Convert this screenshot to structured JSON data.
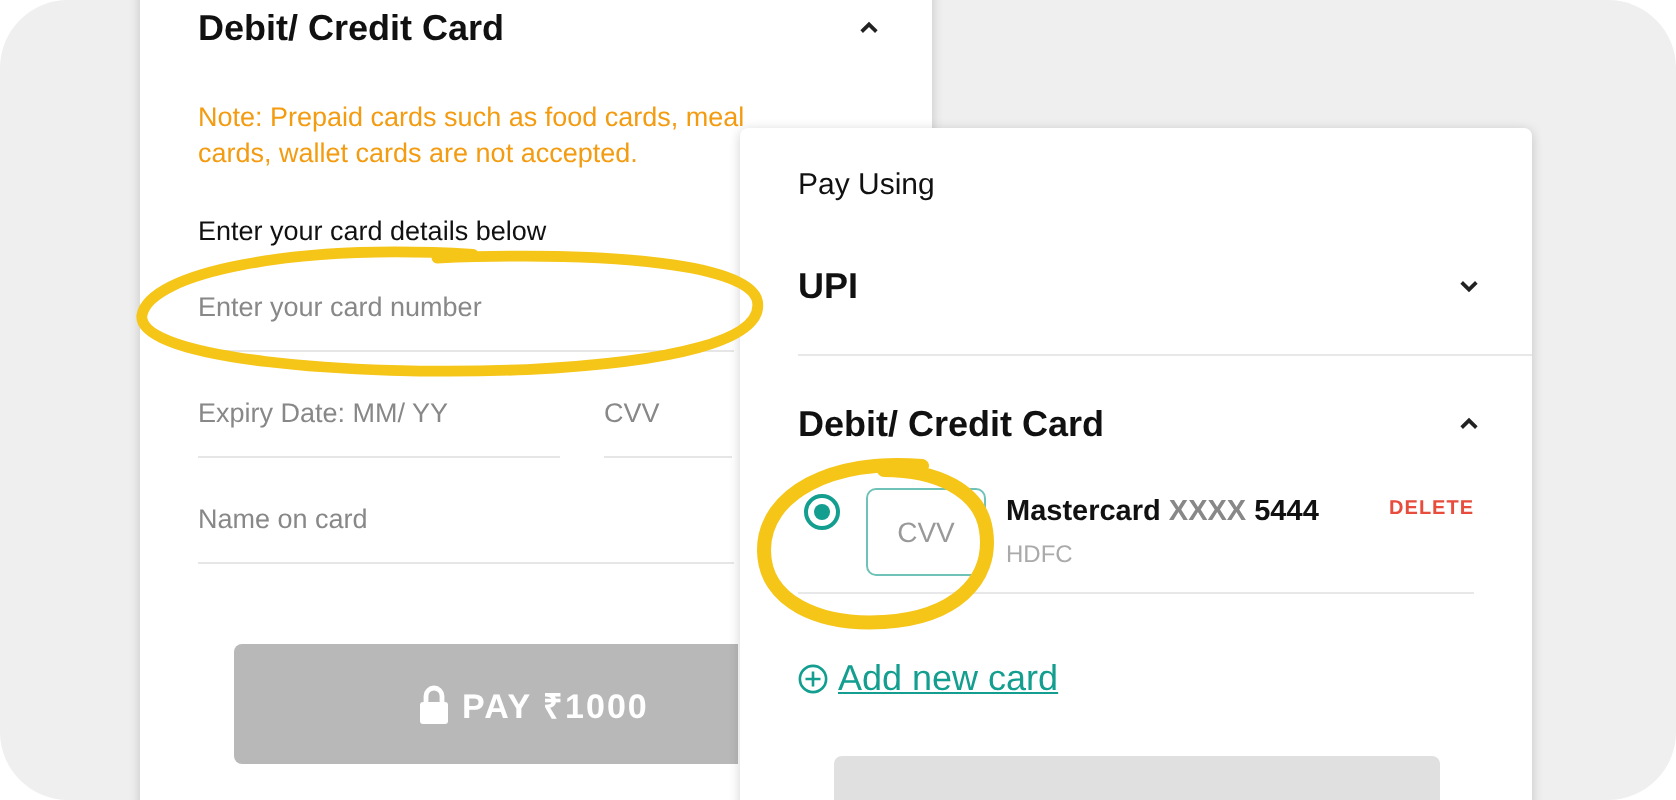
{
  "card_form": {
    "title": "Debit/ Credit Card",
    "expanded": true,
    "note": "Note: Prepaid cards such as food cards, meal cards, wallet cards are not accepted.",
    "instruction": "Enter your card details below",
    "fields": [
      {
        "placeholder": "Enter your card number"
      },
      {
        "placeholder": "Expiry Date: MM/ YY"
      },
      {
        "placeholder": "CVV"
      },
      {
        "placeholder": "Name on card"
      }
    ],
    "pay_button": {
      "label": "PAY ₹1000",
      "disabled": true
    }
  },
  "pay_panel": {
    "heading": "Pay Using",
    "sections": [
      {
        "title": "UPI",
        "expanded": false
      },
      {
        "title": "Debit/ Credit Card",
        "expanded": true
      }
    ],
    "saved_cards": [
      {
        "brand": "Mastercard",
        "masked": "XXXX",
        "last4": "5444",
        "bank": "HDFC",
        "selected": true,
        "cvv_placeholder": "CVV",
        "delete_label": "DELETE"
      }
    ],
    "add_card_link": "Add new card"
  }
}
